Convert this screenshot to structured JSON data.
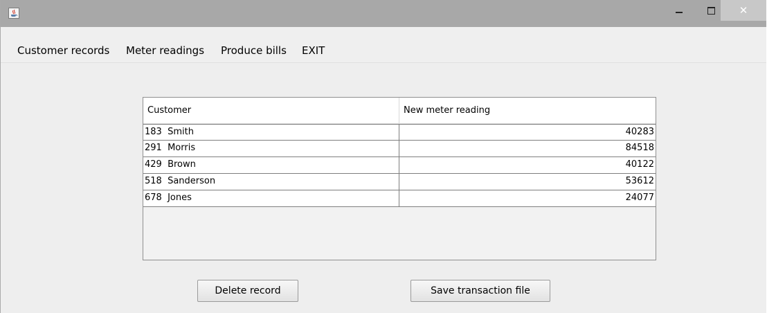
{
  "window": {
    "icon": "java-cup-icon",
    "controls": {
      "minimize_icon": "minimize-icon",
      "maximize_icon": "maximize-icon",
      "close_label": "✕"
    }
  },
  "menu": {
    "items": [
      "Customer records",
      "Meter readings",
      "Produce bills",
      "EXIT"
    ]
  },
  "table": {
    "headers": [
      "Customer",
      "New meter reading"
    ],
    "rows": [
      {
        "customer": "183  Smith",
        "reading": "40283"
      },
      {
        "customer": "291  Morris",
        "reading": "84518"
      },
      {
        "customer": "429  Brown",
        "reading": "40122"
      },
      {
        "customer": "518  Sanderson",
        "reading": "53612"
      },
      {
        "customer": "678  Jones",
        "reading": "24077"
      }
    ]
  },
  "buttons": {
    "delete_label": "Delete record",
    "save_label": "Save transaction file"
  }
}
